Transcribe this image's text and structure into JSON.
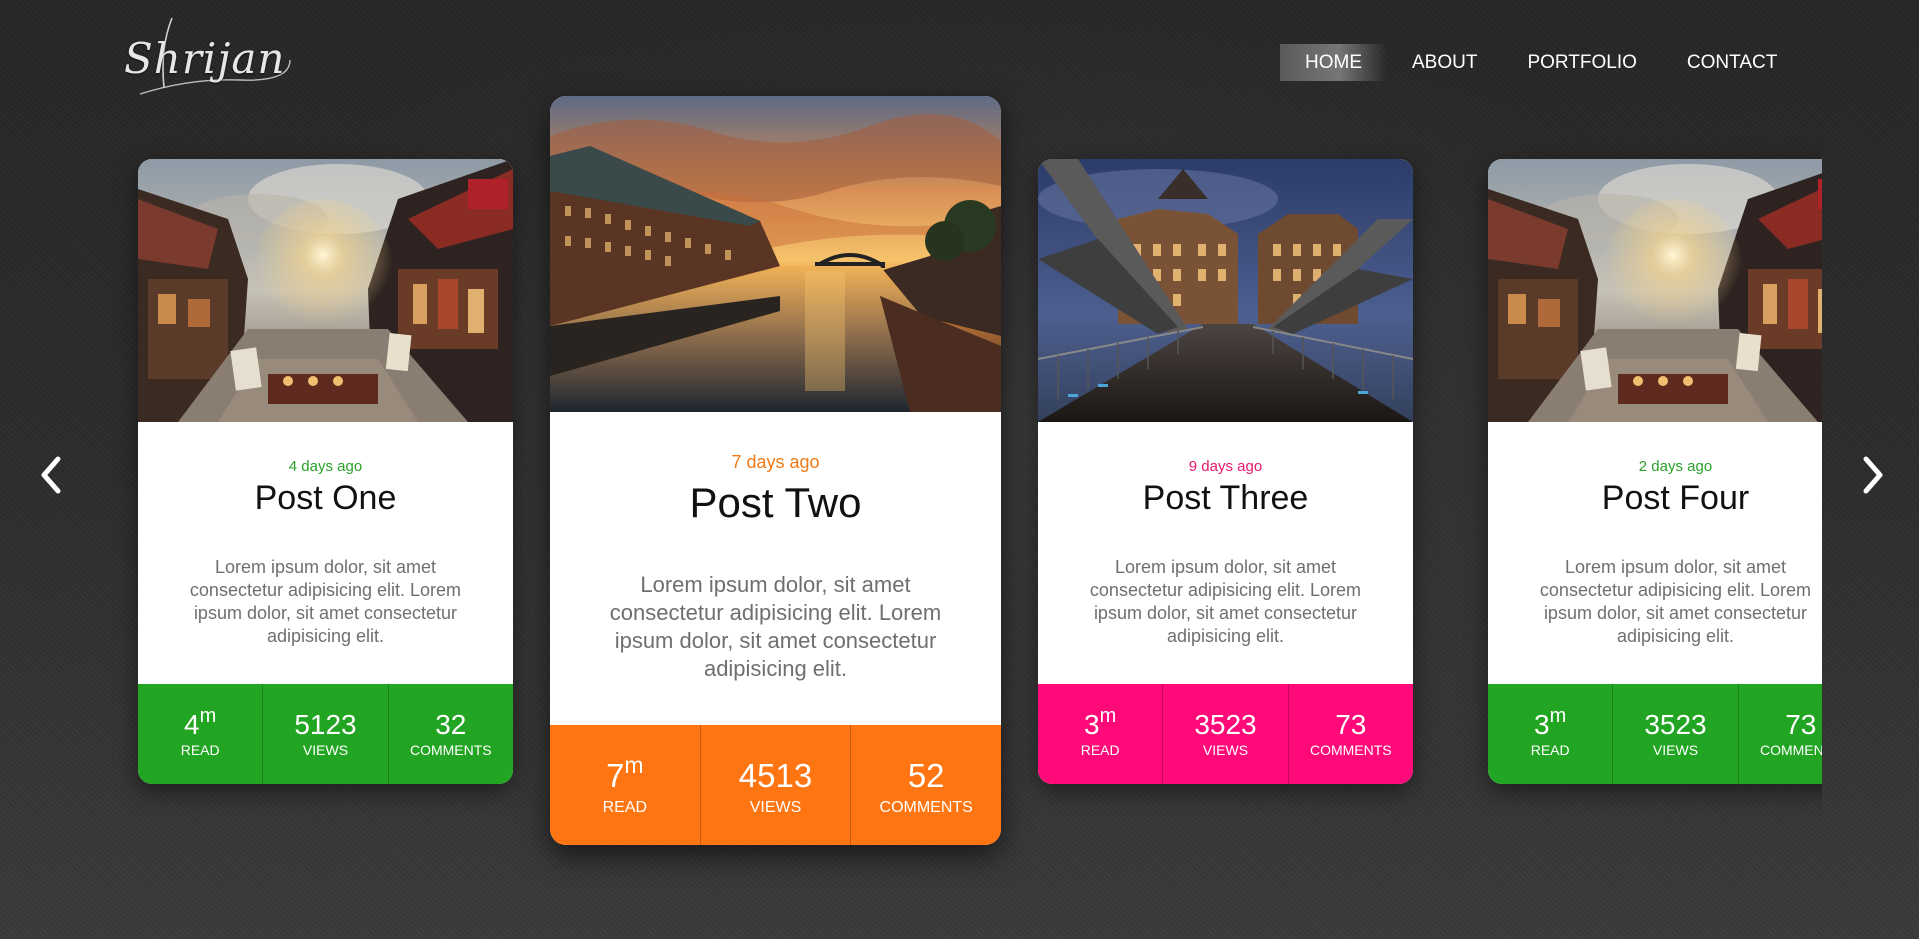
{
  "brand": {
    "logo_text": "Shrijan"
  },
  "nav": {
    "items": [
      {
        "label": "HOME",
        "active": true
      },
      {
        "label": "ABOUT",
        "active": false
      },
      {
        "label": "PORTFOLIO",
        "active": false
      },
      {
        "label": "CONTACT",
        "active": false
      }
    ]
  },
  "carousel": {
    "prev_icon": "chevron-left-icon",
    "next_icon": "chevron-right-icon",
    "posts": [
      {
        "date": "4 days ago",
        "title": "Post One",
        "excerpt": "Lorem ipsum dolor, sit amet consectetur adipisicing elit. Lorem ipsum dolor, sit amet consectetur adipisicing elit.",
        "accent": "#22a522",
        "image": "market-street-photo",
        "read": "4",
        "read_unit": "m",
        "read_label": "READ",
        "views": "5123",
        "views_label": "VIEWS",
        "comments": "32",
        "comments_label": "COMMENTS"
      },
      {
        "date": "7 days ago",
        "title": "Post Two",
        "excerpt": "Lorem ipsum dolor, sit amet consectetur adipisicing elit. Lorem ipsum dolor, sit amet consectetur adipisicing elit.",
        "accent": "#ff7511",
        "image": "canal-sunset-photo",
        "read": "7",
        "read_unit": "m",
        "read_label": "READ",
        "views": "4513",
        "views_label": "VIEWS",
        "comments": "52",
        "comments_label": "COMMENTS"
      },
      {
        "date": "9 days ago",
        "title": "Post Three",
        "excerpt": "Lorem ipsum dolor, sit amet consectetur adipisicing elit. Lorem ipsum dolor, sit amet consectetur adipisicing elit.",
        "accent": "#ff0a78",
        "image": "bridge-warehouse-photo",
        "read": "3",
        "read_unit": "m",
        "read_label": "READ",
        "views": "3523",
        "views_label": "VIEWS",
        "comments": "73",
        "comments_label": "COMMENTS"
      },
      {
        "date": "2 days ago",
        "title": "Post Four",
        "excerpt": "Lorem ipsum dolor, sit amet consectetur adipisicing elit. Lorem ipsum dolor, sit amet consectetur adipisicing elit.",
        "accent": "#22a522",
        "image": "market-street-photo",
        "read": "3",
        "read_unit": "m",
        "read_label": "READ",
        "views": "3523",
        "views_label": "VIEWS",
        "comments": "73",
        "comments_label": "COMMENTS"
      }
    ]
  }
}
